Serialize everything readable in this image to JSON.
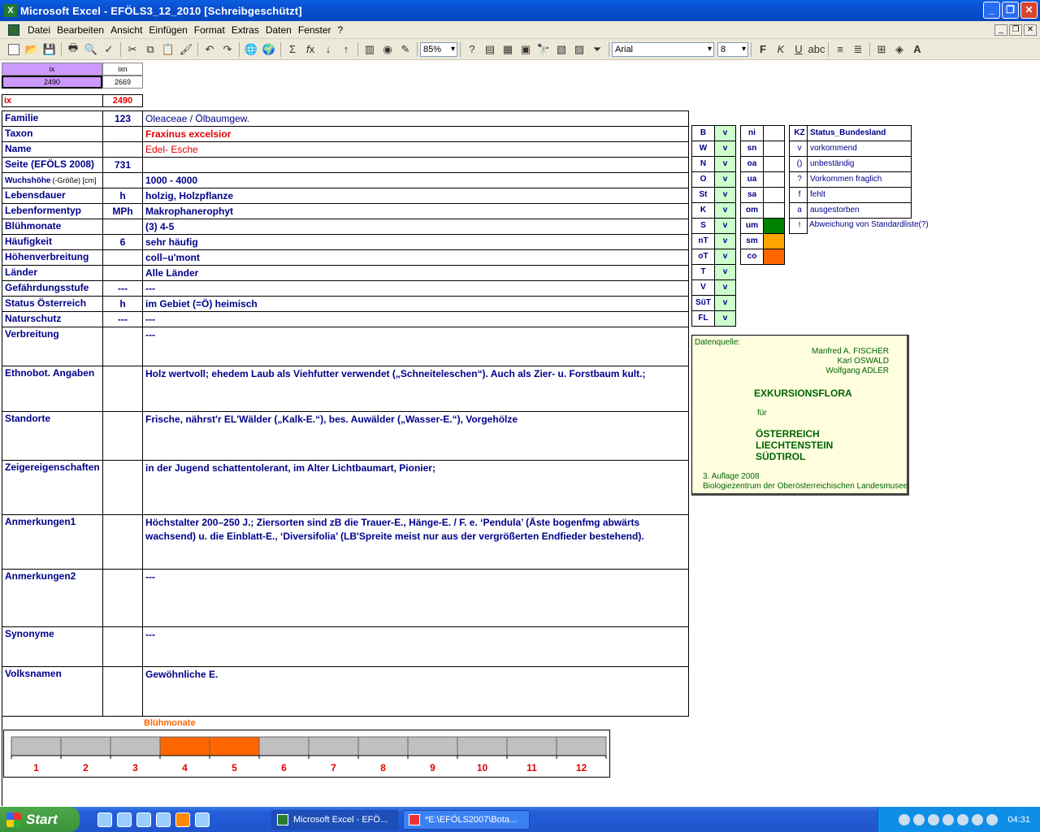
{
  "window": {
    "title": "Microsoft Excel - EFÖLS3_12_2010  [Schreibgeschützt]"
  },
  "menu": [
    "Datei",
    "Bearbeiten",
    "Ansicht",
    "Einfügen",
    "Format",
    "Extras",
    "Daten",
    "Fenster",
    "?"
  ],
  "toolbar": {
    "zoom": "85%",
    "font": "Arial",
    "size": "8"
  },
  "top": {
    "ix_header": "ix",
    "ixn_header": "ixn",
    "ix_value": "2490",
    "ixn_value": "2669",
    "ix_label": "ix",
    "ix_label_value": "2490"
  },
  "rows": [
    {
      "label": "Familie",
      "code": "123",
      "value": "Oleaceae  /  Ölbaumgew."
    },
    {
      "label": "Taxon",
      "code": "",
      "value": "Fraxinus excelsior"
    },
    {
      "label": "Name",
      "code": "",
      "value": "Edel- Esche"
    },
    {
      "label": "Seite (EFÖLS 2008)",
      "code": "731",
      "value": ""
    },
    {
      "label": "Wuchshöhe",
      "label_small": "(-Größe) [cm]",
      "code": "",
      "value": "1000 - 4000"
    },
    {
      "label": "Lebensdauer",
      "code": "h",
      "value": "holzig, Holzpflanze"
    },
    {
      "label": "Lebenformentyp",
      "code": "MPh",
      "value": "Makrophanerophyt"
    },
    {
      "label": "Blühmonate",
      "code": "",
      "value": "(3) 4-5"
    },
    {
      "label": "Häufigkeit",
      "code": "6",
      "value": "sehr häufig"
    },
    {
      "label": "Höhenverbreitung",
      "code": "",
      "value": "coll–u'mont"
    },
    {
      "label": "Länder",
      "code": "",
      "value": "Alle Länder"
    },
    {
      "label": "Gefährdungsstufe",
      "code": "---",
      "value": "---"
    },
    {
      "label": "Status Österreich",
      "code": "h",
      "value": "im Gebiet (=Ö) heimisch"
    },
    {
      "label": "Naturschutz",
      "code": "---",
      "value": "---"
    },
    {
      "label": "Verbreitung",
      "code": "",
      "value": "---"
    },
    {
      "label": "Ethnobot. Angaben",
      "code": "",
      "value": "Holz wertvoll; ehedem Laub als Viehfutter verwendet („Schneiteleschen“). Auch als Zier- u. Forstbaum kult.;"
    },
    {
      "label": "Standorte",
      "code": "",
      "value": "Frische, nährst'r EL'Wälder („Kalk-E.“), bes. Auwälder („Wasser-E.“), Vorgehölze"
    },
    {
      "label": "Zeigereigenschaften",
      "code": "",
      "value": " in der Jugend schattentolerant, im Alter Lichtbaumart, Pionier;"
    },
    {
      "label": "Anmerkungen1",
      "code": "",
      "value": "Höchstalter 200–250 J.; Ziersorten sind zB die Trauer-E., Hänge-E. / F. e. ‘Pendula’ (Äste bogenfmg abwärts wachsend) u. die Einblatt-E., ‘Diversifolia’ (LB'Spreite meist nur aus der vergrößerten Endfieder bestehend)."
    },
    {
      "label": "Anmerkungen2",
      "code": "",
      "value": "---"
    },
    {
      "label": "Synonyme",
      "code": "",
      "value": "---"
    },
    {
      "label": "Volksnamen",
      "code": "",
      "value": "Gewöhnliche E."
    }
  ],
  "states": [
    {
      "code": "B",
      "v": "v"
    },
    {
      "code": "W",
      "v": "v"
    },
    {
      "code": "N",
      "v": "v"
    },
    {
      "code": "O",
      "v": "v"
    },
    {
      "code": "St",
      "v": "v"
    },
    {
      "code": "K",
      "v": "v"
    },
    {
      "code": "S",
      "v": "v"
    },
    {
      "code": "nT",
      "v": "v"
    },
    {
      "code": "oT",
      "v": "v"
    },
    {
      "code": "T",
      "v": "v"
    },
    {
      "code": "V",
      "v": "v"
    },
    {
      "code": "SüT",
      "v": "v"
    },
    {
      "code": "FL",
      "v": "v"
    }
  ],
  "altitude": [
    {
      "code": "ni",
      "color": ""
    },
    {
      "code": "sn",
      "color": ""
    },
    {
      "code": "oa",
      "color": ""
    },
    {
      "code": "ua",
      "color": ""
    },
    {
      "code": "sa",
      "color": ""
    },
    {
      "code": "om",
      "color": ""
    },
    {
      "code": "um",
      "color": "#008000"
    },
    {
      "code": "sm",
      "color": "#ffa500"
    },
    {
      "code": "co",
      "color": "#ff6600"
    }
  ],
  "legend": {
    "header_kz": "KZ",
    "header_status": "Status_Bundesland",
    "items": [
      {
        "kz": "v",
        "text": "vorkommend"
      },
      {
        "kz": "()",
        "text": "unbeständig"
      },
      {
        "kz": "?",
        "text": "Vorkommen fraglich"
      },
      {
        "kz": "f",
        "text": "fehlt"
      },
      {
        "kz": "a",
        "text": "ausgestorben"
      },
      {
        "kz": "!",
        "text": "Abweichung von Standardliste(?)"
      }
    ]
  },
  "source": {
    "label": "Datenquelle:",
    "authors": [
      "Manfred A. FISCHER",
      "Karl OSWALD",
      "Wolfgang ADLER"
    ],
    "title": "EXKURSIONSFLORA",
    "fuer": "für",
    "countries": [
      "ÖSTERREICH",
      "LIECHTENSTEIN",
      "SÜDTIROL"
    ],
    "edition": "3. Auflage 2008",
    "publisher": "Biologiezentrum der Oberösterreichischen Landesmuseen"
  },
  "chart_data": {
    "type": "bar",
    "title": "Blühmonate",
    "categories": [
      "1",
      "2",
      "3",
      "4",
      "5",
      "6",
      "7",
      "8",
      "9",
      "10",
      "11",
      "12"
    ],
    "values": [
      0,
      0,
      0,
      1,
      1,
      0,
      0,
      0,
      0,
      0,
      0,
      0
    ],
    "colors": {
      "active": "#ff6600",
      "inactive": "#c0c0c0"
    }
  },
  "taskbar": {
    "start": "Start",
    "tasks": [
      "Microsoft Excel - EFÖ...",
      "*E:\\EFÖLS2007\\Bota..."
    ],
    "clock": "04:31"
  }
}
